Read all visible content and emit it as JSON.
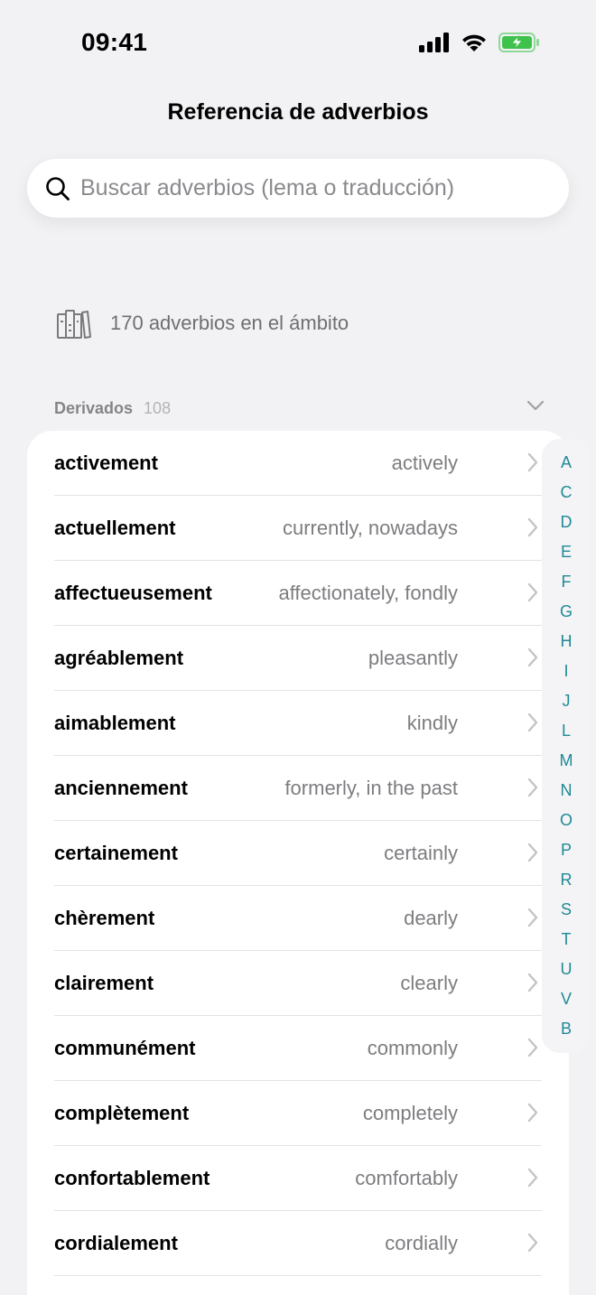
{
  "status_bar": {
    "time": "09:41",
    "icons": [
      "signal-icon",
      "wifi-icon",
      "battery-charging-icon"
    ],
    "battery_color": "#3fc24b"
  },
  "nav": {
    "title": "Referencia de adverbios"
  },
  "search": {
    "placeholder": "Buscar adverbios (lema o traducción)",
    "value": ""
  },
  "summary": {
    "icon": "books-icon",
    "text": "170 adverbios en el ámbito"
  },
  "section": {
    "title": "Derivados",
    "count": "108",
    "chevron": "chevron-down-icon"
  },
  "rows": [
    {
      "lemma": "activement",
      "translation": "actively"
    },
    {
      "lemma": "actuellement",
      "translation": "currently, nowadays"
    },
    {
      "lemma": "affectueusement",
      "translation": "affectionately, fondly"
    },
    {
      "lemma": "agréablement",
      "translation": "pleasantly"
    },
    {
      "lemma": "aimablement",
      "translation": "kindly"
    },
    {
      "lemma": "anciennement",
      "translation": "formerly, in the past"
    },
    {
      "lemma": "certainement",
      "translation": "certainly"
    },
    {
      "lemma": "chèrement",
      "translation": "dearly"
    },
    {
      "lemma": "clairement",
      "translation": "clearly"
    },
    {
      "lemma": "communément",
      "translation": "commonly"
    },
    {
      "lemma": "complètement",
      "translation": "completely"
    },
    {
      "lemma": "confortablement",
      "translation": "comfortably"
    },
    {
      "lemma": "cordialement",
      "translation": "cordially"
    }
  ],
  "alphabet_index": [
    "A",
    "C",
    "D",
    "E",
    "F",
    "G",
    "H",
    "I",
    "J",
    "L",
    "M",
    "N",
    "O",
    "P",
    "R",
    "S",
    "T",
    "U",
    "V",
    "B"
  ],
  "colors": {
    "accent": "#1f8a96",
    "background": "#f2f2f4",
    "card": "#ffffff"
  }
}
